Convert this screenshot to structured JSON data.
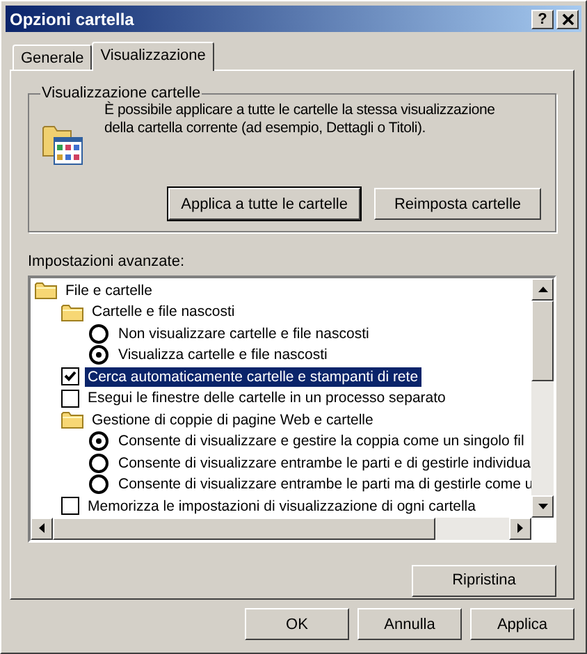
{
  "window": {
    "title": "Opzioni cartella",
    "help_button": "?"
  },
  "tabs": [
    {
      "label": "Generale",
      "selected": false
    },
    {
      "label": "Visualizzazione",
      "selected": true
    }
  ],
  "folder_views": {
    "title": "Visualizzazione cartelle",
    "description": "È possibile applicare a tutte le cartelle la stessa visualizzazione della cartella corrente (ad esempio, Dettagli o Titoli).",
    "buttons": [
      {
        "label": "Applica a tutte le cartelle",
        "default": true
      },
      {
        "label": "Reimposta cartelle",
        "default": false
      }
    ]
  },
  "advanced": {
    "label": "Impostazioni avanzate:",
    "items": [
      {
        "kind": "folder",
        "label": "File e cartelle",
        "selected": false,
        "children": [
          {
            "kind": "folder",
            "label": "Cartelle e file nascosti",
            "selected": false,
            "children": [
              {
                "kind": "radio",
                "label": "Non visualizzare cartelle e file nascosti",
                "checked": false,
                "selected": false
              },
              {
                "kind": "radio",
                "label": "Visualizza cartelle e file nascosti",
                "checked": true,
                "selected": false
              }
            ]
          },
          {
            "kind": "checkbox",
            "label": "Cerca automaticamente cartelle e stampanti di rete",
            "checked": true,
            "selected": true
          },
          {
            "kind": "checkbox",
            "label": "Esegui le finestre delle cartelle in un processo separato",
            "checked": false,
            "selected": false
          },
          {
            "kind": "folder",
            "label": "Gestione di coppie di pagine Web e cartelle",
            "selected": false,
            "children": [
              {
                "kind": "radio",
                "label": "Consente di visualizzare e gestire la coppia come un singolo fil",
                "checked": true,
                "selected": false
              },
              {
                "kind": "radio",
                "label": "Consente di visualizzare entrambe le parti e di gestirle individua",
                "checked": false,
                "selected": false
              },
              {
                "kind": "radio",
                "label": "Consente di visualizzare entrambe le parti ma di gestirle come u",
                "checked": false,
                "selected": false
              }
            ]
          },
          {
            "kind": "checkbox",
            "label": "Memorizza le impostazioni di visualizzazione di ogni cartella",
            "checked": false,
            "selected": false
          }
        ]
      }
    ]
  },
  "restore_button": "Ripristina",
  "buttons": [
    "OK",
    "Annulla",
    "Applica"
  ]
}
